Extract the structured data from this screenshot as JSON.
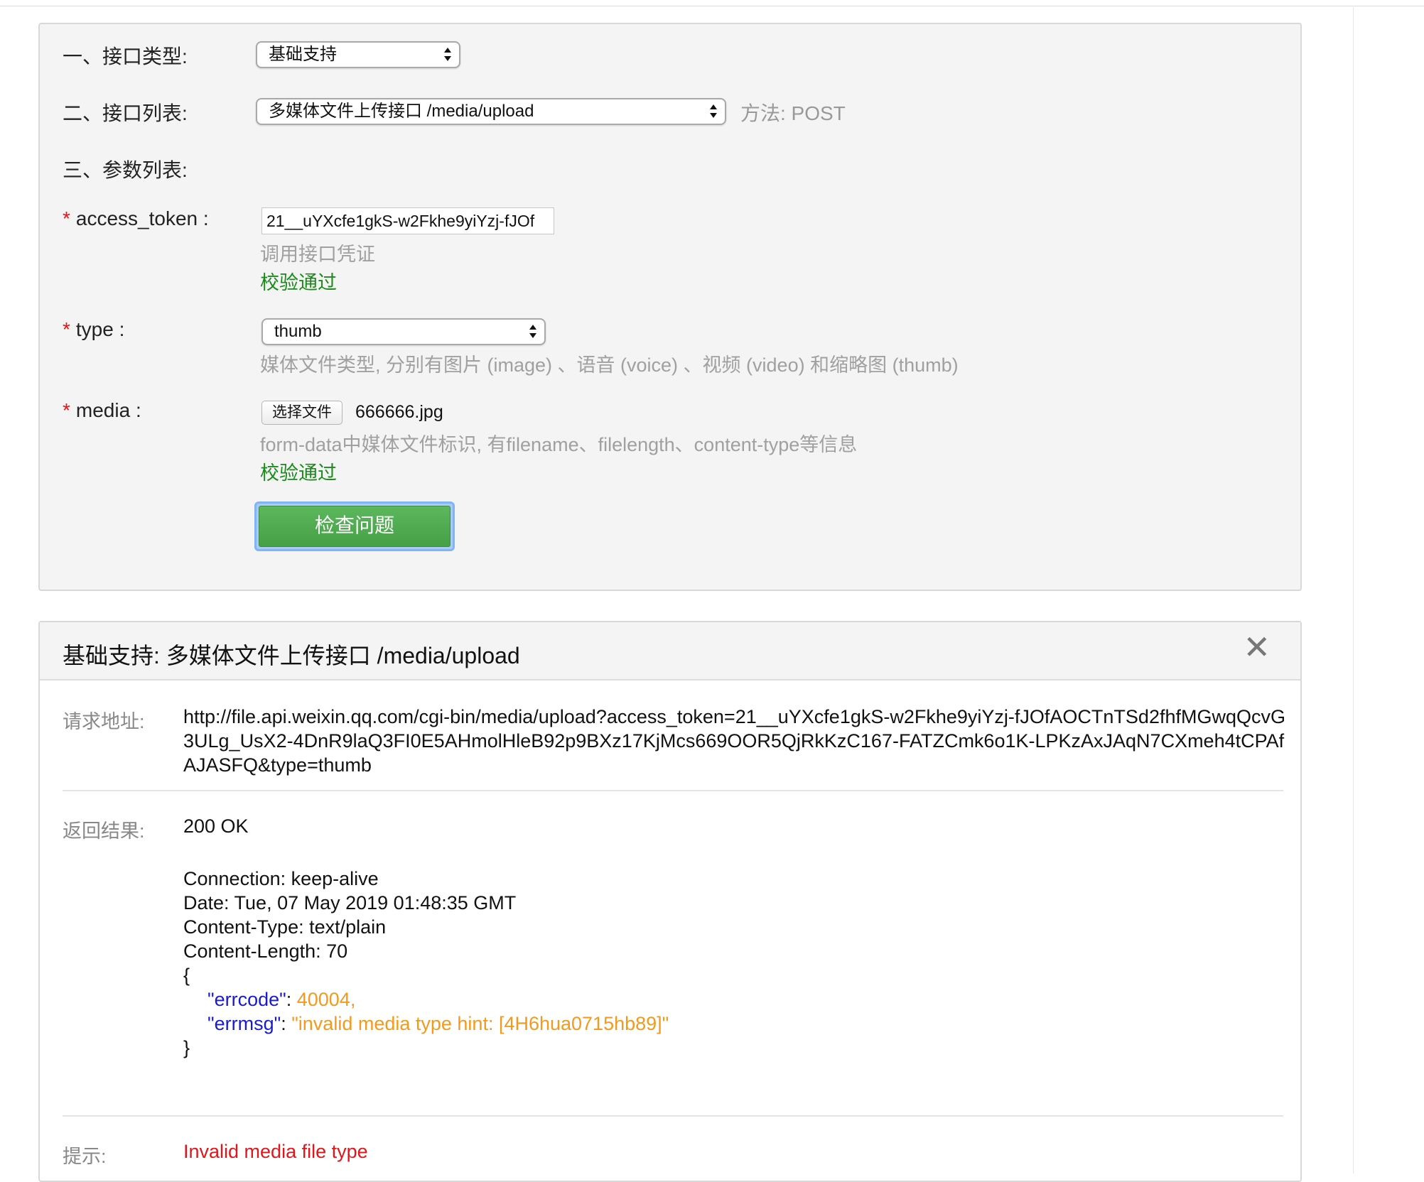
{
  "form": {
    "api_type_label": "一、接口类型:",
    "api_type_value": "基础支持",
    "api_list_label": "二、接口列表:",
    "api_list_value": "多媒体文件上传接口 /media/upload",
    "method_text": "方法: POST",
    "params_label": "三、参数列表:",
    "params": [
      {
        "name": "access_token :",
        "value": "21__uYXcfe1gkS-w2Fkhe9yiYzj-fJOf",
        "hint": "调用接口凭证",
        "status": "校验通过"
      },
      {
        "name": "type :",
        "value": "thumb",
        "hint": "媒体文件类型, 分别有图片 (image) 、语音 (voice) 、视频 (video) 和缩略图 (thumb)"
      },
      {
        "name": "media :",
        "button_label": "选择文件",
        "file_name": "666666.jpg",
        "hint": "form-data中媒体文件标识, 有filename、filelength、content-type等信息",
        "status": "校验通过"
      }
    ],
    "submit_label": "检查问题"
  },
  "result": {
    "title": "基础支持: 多媒体文件上传接口 /media/upload",
    "close_glyph": "✕",
    "request_url_label": "请求地址:",
    "request_url": "http://file.api.weixin.qq.com/cgi-bin/media/upload?access_token=21__uYXcfe1gkS-w2Fkhe9yiYzj-fJOfAOCTnTSd2fhfMGwqQcvG3ULg_UsX2-4DnR9laQ3FI0E5AHmolHleB92p9BXz17KjMcs669OOR5QjRkKzC167-FATZCmk6o1K-LPKzAxJAqN7CXmeh4tCPAfAJASFQ&type=thumb",
    "response_label": "返回结果:",
    "status_line": "200 OK",
    "headers": [
      "Connection: keep-alive",
      "Date: Tue, 07 May 2019 01:48:35 GMT",
      "Content-Type: text/plain",
      "Content-Length: 70"
    ],
    "json_open": "{",
    "json_close": "}",
    "errcode_key": "\"errcode\"",
    "errcode_value": "40004,",
    "errmsg_key": "\"errmsg\"",
    "errmsg_value": "\"invalid media type hint: [4H6hua0715hb89]\"",
    "colon": ": ",
    "tip_label": "提示:",
    "tip_value": "Invalid media file type"
  },
  "colors": {
    "required_star": "#e0161b",
    "success_green": "#1a8a1a",
    "button_green": "#5cb85c",
    "json_key_blue": "#1a1ad0",
    "json_value_orange": "#f39a1e",
    "error_red": "#e0161b"
  }
}
